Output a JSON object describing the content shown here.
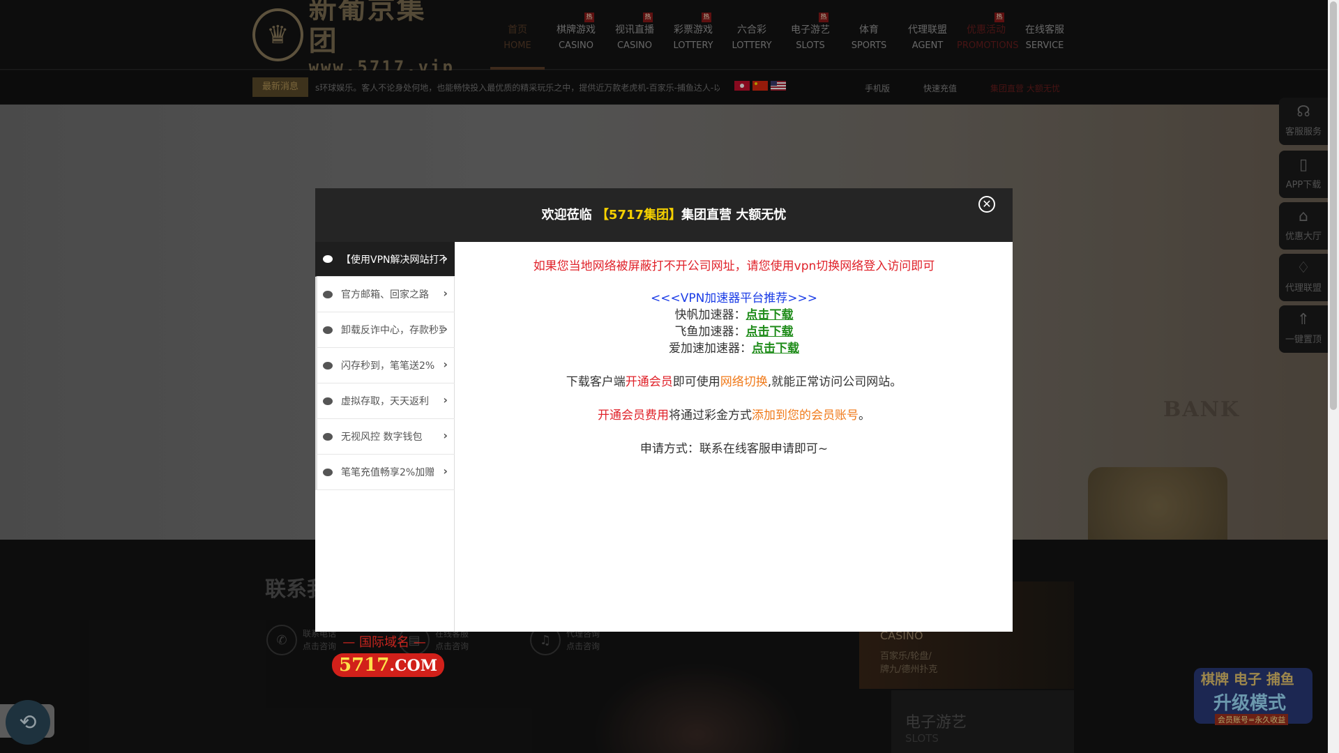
{
  "header": {
    "logo_cn": "新葡京集团",
    "logo_url": "www.5717.vip",
    "nav": [
      {
        "cn": "首页",
        "en": "HOME",
        "state": "active",
        "hot": ""
      },
      {
        "cn": "棋牌游戏",
        "en": "CASINO",
        "state": "",
        "hot": "热"
      },
      {
        "cn": "视讯直播",
        "en": "CASINO",
        "state": "",
        "hot": "热"
      },
      {
        "cn": "彩票游戏",
        "en": "LOTTERY",
        "state": "",
        "hot": "热"
      },
      {
        "cn": "六合彩",
        "en": "LOTTERY",
        "state": "",
        "hot": ""
      },
      {
        "cn": "电子游艺",
        "en": "SLOTS",
        "state": "",
        "hot": "热"
      },
      {
        "cn": "体育",
        "en": "SPORTS",
        "state": "",
        "hot": ""
      },
      {
        "cn": "代理联盟",
        "en": "AGENT",
        "state": "",
        "hot": ""
      },
      {
        "cn": "优惠活动",
        "en": "PROMOTIONS",
        "state": "promo",
        "hot": "热"
      },
      {
        "cn": "在线客服",
        "en": "SERVICE",
        "state": "",
        "hot": ""
      }
    ]
  },
  "newsbar": {
    "label": "最新消息",
    "text": "s环球娱乐。客人不论身处何地，也能畅快投入最优质的精采玩乐之中，提供近万款老虎机-百家乐-捕鱼达人-以",
    "links": [
      "手机版",
      "快速充值",
      "集团直营 大额无忧"
    ]
  },
  "banner": {
    "bank_text": "BANK"
  },
  "contact": {
    "title": "联系我",
    "items": [
      {
        "l1": "联系电话",
        "l2": "点击咨询"
      },
      {
        "l1": "在线客服",
        "l2": "点击咨询"
      },
      {
        "l1": "代理咨询",
        "l2": "点击咨询"
      }
    ]
  },
  "cards": {
    "casino": {
      "t1": "CASINO",
      "t2a": "百家乐/轮盘/",
      "t2b": "牌九/德州扑克"
    },
    "slots": {
      "t1": "电子游艺",
      "t2": "SLOTS"
    }
  },
  "side_float": [
    "客服服务",
    "APP下载",
    "优惠大厅",
    "代理联盟",
    "一键置顶"
  ],
  "promo_float": {
    "l1": "棋牌 电子 捕鱼",
    "l2": "升级模式",
    "l3": "会员账号=永久收益"
  },
  "modal": {
    "title_pre": "欢迎莅临",
    "title_hl": "【5717集团】",
    "title_post": "集团直营 大额无忧",
    "tabs": [
      "【使用VPN解决网站打不开问题】",
      "官方邮箱、回家之路",
      "卸载反诈中心，存款秒到",
      "闪存秒到，笔笔送2%",
      "虚拟存取，天天返利",
      "无视风控 数字钱包",
      "笔笔充值畅享2%加赠"
    ],
    "domain_caption": "— 国际域名 —",
    "domain_number": "5717",
    "domain_suffix": ".COM",
    "body": {
      "line1": "如果您当地网络被屏蔽打不开公司网址，请您使用vpn切换网络登入访问即可",
      "vpn_heading": "<<<VPN加速器平台推荐>>>",
      "vpn": [
        {
          "name": "快帆加速器：",
          "link": "点击下载"
        },
        {
          "name": "飞鱼加速器：",
          "link": "点击下载"
        },
        {
          "name": "爱加速加速器：",
          "link": "点击下载"
        }
      ],
      "p2_a": "下载客户端",
      "p2_b": "开通会员",
      "p2_c": "即可使用",
      "p2_d": "网络切换",
      "p2_e": ",就能正常访问公司网站。",
      "p3_a": "开通会员费用",
      "p3_b": "将通过彩金方式",
      "p3_c": "添加到您的会员账号",
      "p3_d": "。",
      "p4": "申请方式：联系在线客服申请即可~"
    }
  },
  "colors": {
    "accent_gold": "#f5d000",
    "link_green": "#1f8c1a",
    "alert_red": "#e0222a",
    "vpn_blue": "#1a3ce6",
    "highlight_orange": "#f07a1a"
  }
}
